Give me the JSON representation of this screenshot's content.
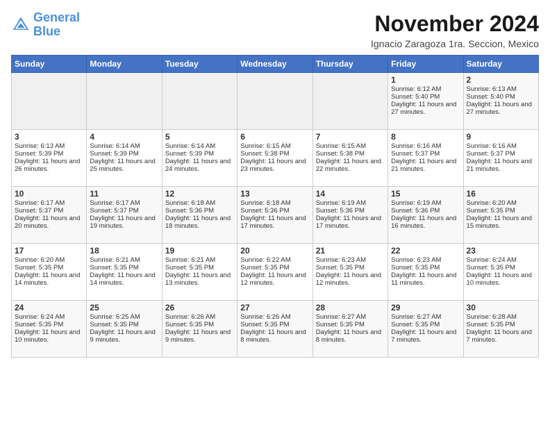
{
  "logo": {
    "line1": "General",
    "line2": "Blue"
  },
  "title": "November 2024",
  "location": "Ignacio Zaragoza 1ra. Seccion, Mexico",
  "days_of_week": [
    "Sunday",
    "Monday",
    "Tuesday",
    "Wednesday",
    "Thursday",
    "Friday",
    "Saturday"
  ],
  "weeks": [
    [
      {
        "day": "",
        "info": ""
      },
      {
        "day": "",
        "info": ""
      },
      {
        "day": "",
        "info": ""
      },
      {
        "day": "",
        "info": ""
      },
      {
        "day": "",
        "info": ""
      },
      {
        "day": "1",
        "info": "Sunrise: 6:12 AM\nSunset: 5:40 PM\nDaylight: 11 hours and 27 minutes."
      },
      {
        "day": "2",
        "info": "Sunrise: 6:13 AM\nSunset: 5:40 PM\nDaylight: 11 hours and 27 minutes."
      }
    ],
    [
      {
        "day": "3",
        "info": "Sunrise: 6:13 AM\nSunset: 5:39 PM\nDaylight: 11 hours and 26 minutes."
      },
      {
        "day": "4",
        "info": "Sunrise: 6:14 AM\nSunset: 5:39 PM\nDaylight: 11 hours and 25 minutes."
      },
      {
        "day": "5",
        "info": "Sunrise: 6:14 AM\nSunset: 5:39 PM\nDaylight: 11 hours and 24 minutes."
      },
      {
        "day": "6",
        "info": "Sunrise: 6:15 AM\nSunset: 5:38 PM\nDaylight: 11 hours and 23 minutes."
      },
      {
        "day": "7",
        "info": "Sunrise: 6:15 AM\nSunset: 5:38 PM\nDaylight: 11 hours and 22 minutes."
      },
      {
        "day": "8",
        "info": "Sunrise: 6:16 AM\nSunset: 5:37 PM\nDaylight: 11 hours and 21 minutes."
      },
      {
        "day": "9",
        "info": "Sunrise: 6:16 AM\nSunset: 5:37 PM\nDaylight: 11 hours and 21 minutes."
      }
    ],
    [
      {
        "day": "10",
        "info": "Sunrise: 6:17 AM\nSunset: 5:37 PM\nDaylight: 11 hours and 20 minutes."
      },
      {
        "day": "11",
        "info": "Sunrise: 6:17 AM\nSunset: 5:37 PM\nDaylight: 11 hours and 19 minutes."
      },
      {
        "day": "12",
        "info": "Sunrise: 6:18 AM\nSunset: 5:36 PM\nDaylight: 11 hours and 18 minutes."
      },
      {
        "day": "13",
        "info": "Sunrise: 6:18 AM\nSunset: 5:36 PM\nDaylight: 11 hours and 17 minutes."
      },
      {
        "day": "14",
        "info": "Sunrise: 6:19 AM\nSunset: 5:36 PM\nDaylight: 11 hours and 17 minutes."
      },
      {
        "day": "15",
        "info": "Sunrise: 6:19 AM\nSunset: 5:36 PM\nDaylight: 11 hours and 16 minutes."
      },
      {
        "day": "16",
        "info": "Sunrise: 6:20 AM\nSunset: 5:35 PM\nDaylight: 11 hours and 15 minutes."
      }
    ],
    [
      {
        "day": "17",
        "info": "Sunrise: 6:20 AM\nSunset: 5:35 PM\nDaylight: 11 hours and 14 minutes."
      },
      {
        "day": "18",
        "info": "Sunrise: 6:21 AM\nSunset: 5:35 PM\nDaylight: 11 hours and 14 minutes."
      },
      {
        "day": "19",
        "info": "Sunrise: 6:21 AM\nSunset: 5:35 PM\nDaylight: 11 hours and 13 minutes."
      },
      {
        "day": "20",
        "info": "Sunrise: 6:22 AM\nSunset: 5:35 PM\nDaylight: 11 hours and 12 minutes."
      },
      {
        "day": "21",
        "info": "Sunrise: 6:23 AM\nSunset: 5:35 PM\nDaylight: 11 hours and 12 minutes."
      },
      {
        "day": "22",
        "info": "Sunrise: 6:23 AM\nSunset: 5:35 PM\nDaylight: 11 hours and 11 minutes."
      },
      {
        "day": "23",
        "info": "Sunrise: 6:24 AM\nSunset: 5:35 PM\nDaylight: 11 hours and 10 minutes."
      }
    ],
    [
      {
        "day": "24",
        "info": "Sunrise: 6:24 AM\nSunset: 5:35 PM\nDaylight: 11 hours and 10 minutes."
      },
      {
        "day": "25",
        "info": "Sunrise: 6:25 AM\nSunset: 5:35 PM\nDaylight: 11 hours and 9 minutes."
      },
      {
        "day": "26",
        "info": "Sunrise: 6:26 AM\nSunset: 5:35 PM\nDaylight: 11 hours and 9 minutes."
      },
      {
        "day": "27",
        "info": "Sunrise: 6:26 AM\nSunset: 5:35 PM\nDaylight: 11 hours and 8 minutes."
      },
      {
        "day": "28",
        "info": "Sunrise: 6:27 AM\nSunset: 5:35 PM\nDaylight: 11 hours and 8 minutes."
      },
      {
        "day": "29",
        "info": "Sunrise: 6:27 AM\nSunset: 5:35 PM\nDaylight: 11 hours and 7 minutes."
      },
      {
        "day": "30",
        "info": "Sunrise: 6:28 AM\nSunset: 5:35 PM\nDaylight: 11 hours and 7 minutes."
      }
    ]
  ]
}
